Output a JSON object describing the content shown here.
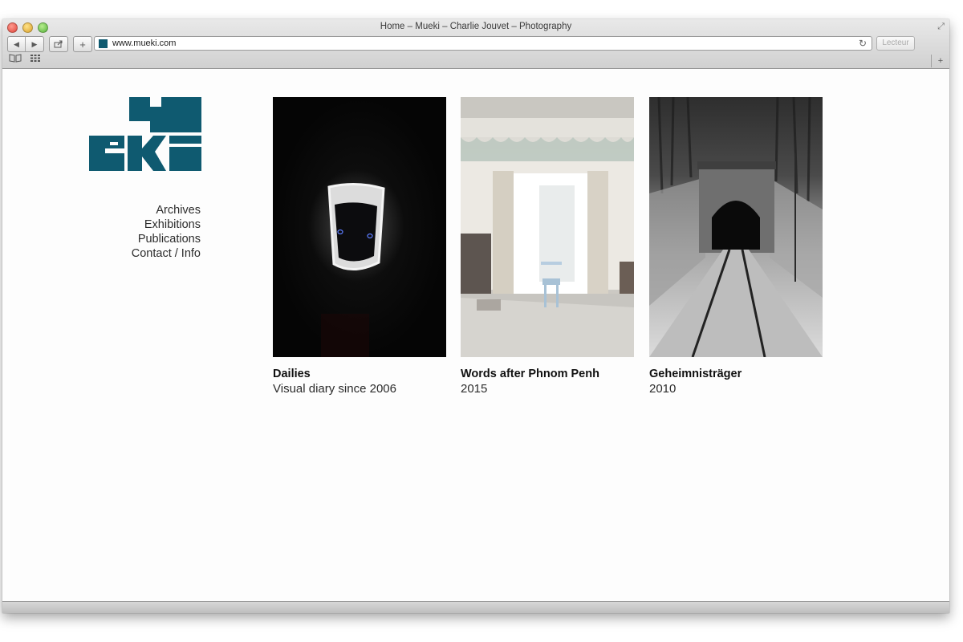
{
  "window": {
    "title": "Home – Mueki – Charlie Jouvet – Photography"
  },
  "toolbar": {
    "url": "www.mueki.com",
    "reader_label": "Lecteur"
  },
  "nav": {
    "items": [
      "Archives",
      "Exhibitions",
      "Publications",
      "Contact / Info"
    ]
  },
  "projects": [
    {
      "title": "Dailies",
      "subtitle": "Visual diary since 2006"
    },
    {
      "title": "Words after Phnom Penh",
      "subtitle": "2015"
    },
    {
      "title": "Geheimnisträger",
      "subtitle": "2010"
    }
  ],
  "colors": {
    "brand": "#0f5a70"
  },
  "icons": {
    "back": "back-arrow-icon",
    "forward": "forward-arrow-icon",
    "share": "share-icon",
    "add": "plus-icon",
    "reload": "reload-icon",
    "bookmarks": "book-icon",
    "top_sites": "grid-icon"
  }
}
